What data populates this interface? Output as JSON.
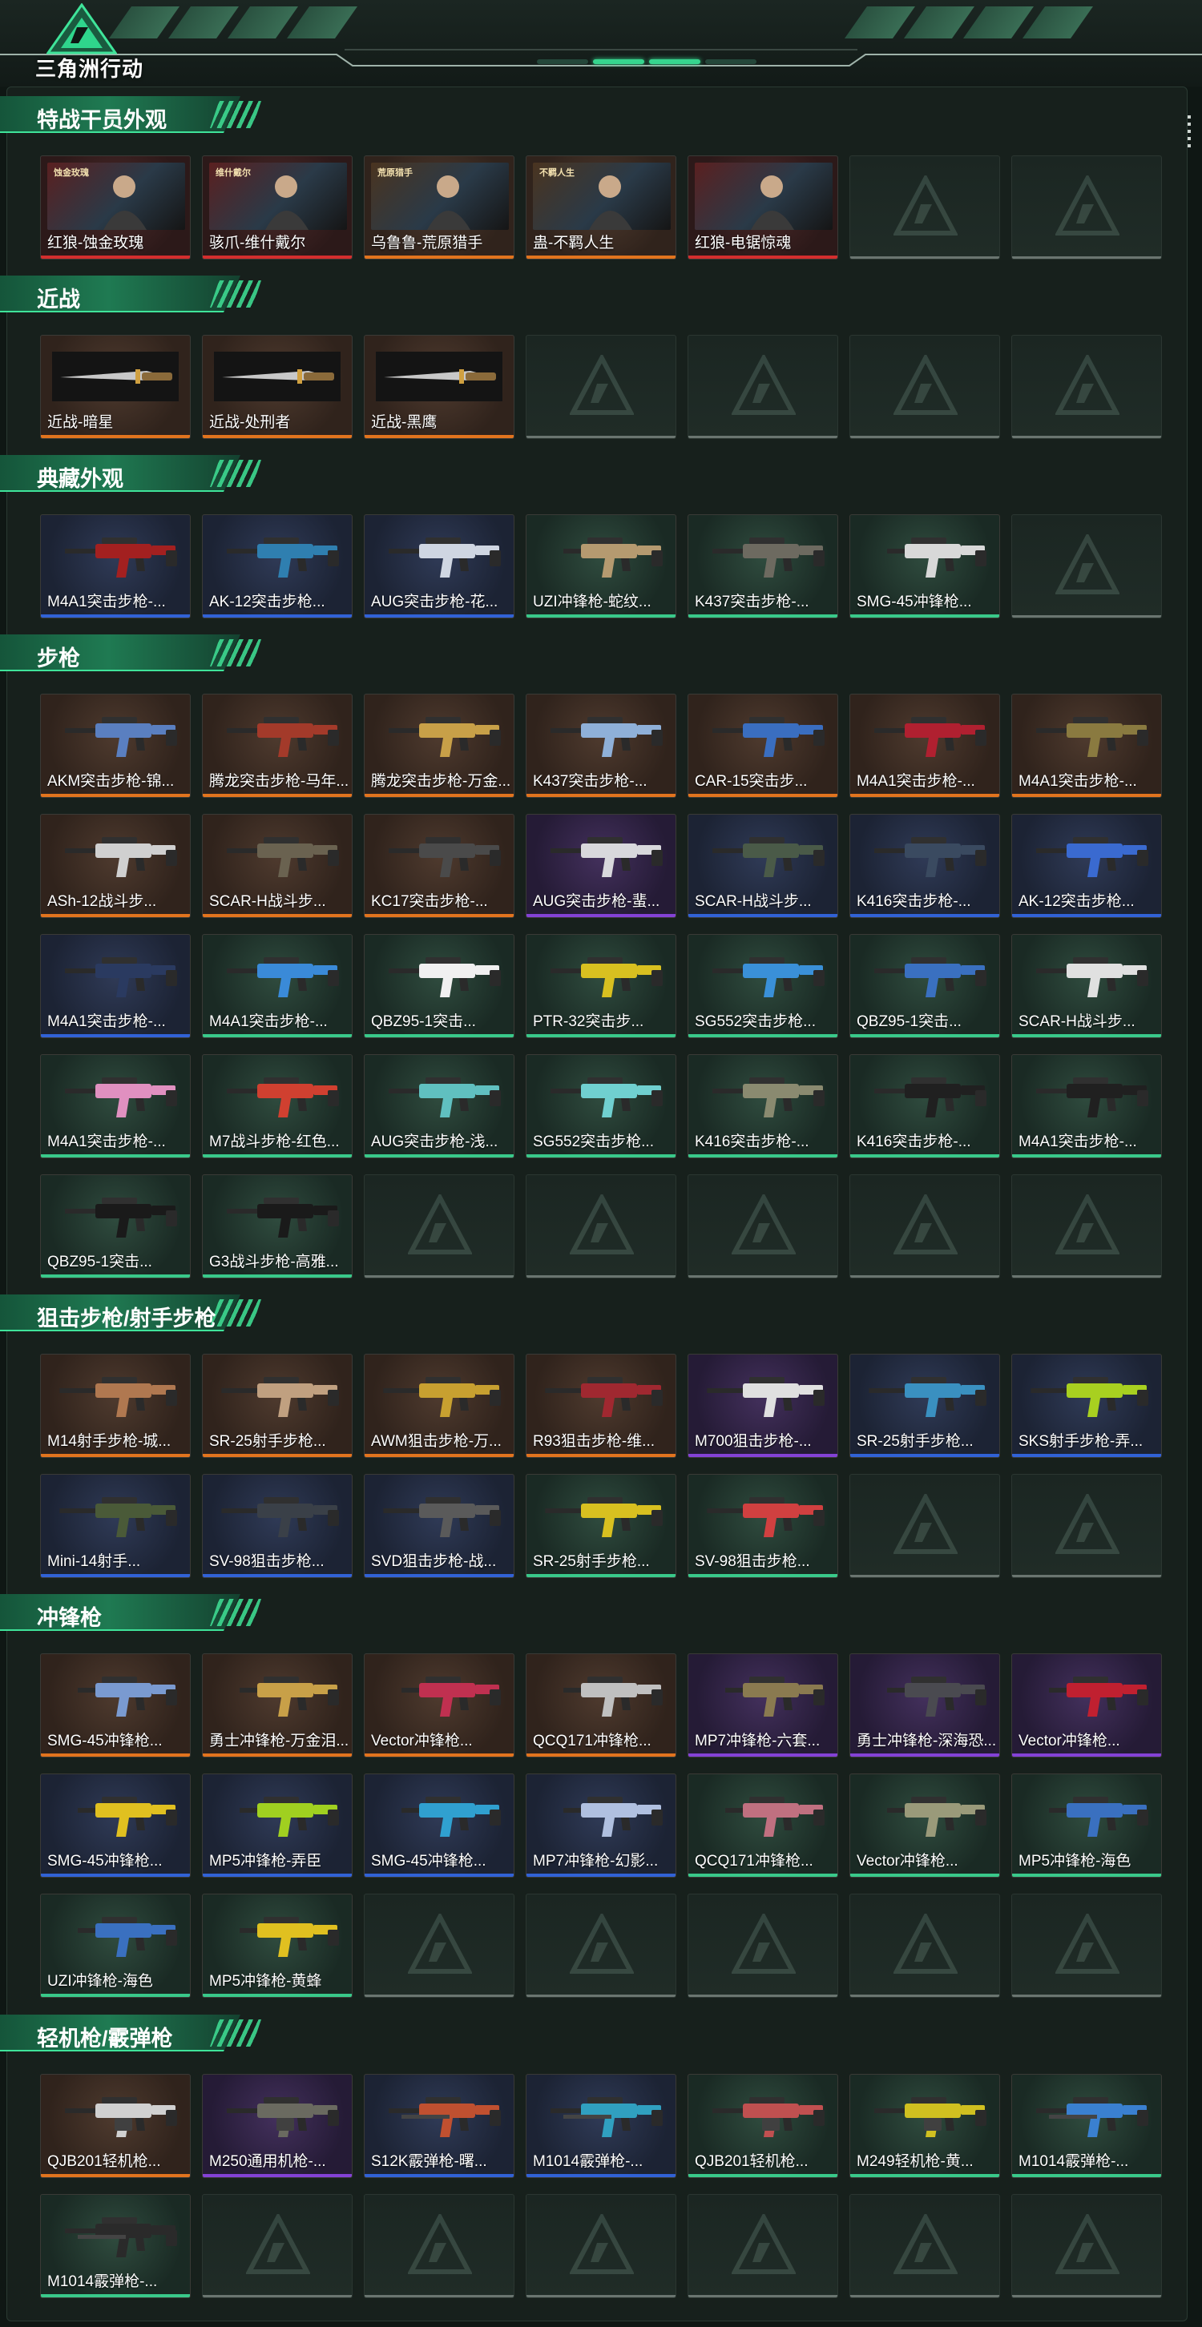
{
  "app": {
    "title": "三角洲行动"
  },
  "theme": {
    "quality_colors": {
      "orange": "#e2741e",
      "blue": "#3162d6",
      "green": "#39c98a",
      "purple": "#8442d6",
      "red": "#d42e2e",
      "empty": "#6a7570"
    }
  },
  "sections": [
    {
      "title": "特战干员外观",
      "kind": "operator",
      "items": [
        {
          "label": "红狼-蚀金玫瑰",
          "quality": "red",
          "icon": "operator-portrait-icon",
          "tag": "蚀金玫瑰"
        },
        {
          "label": "骇爪-维什戴尔",
          "quality": "red",
          "icon": "operator-portrait-icon",
          "tag": "维什戴尔"
        },
        {
          "label": "乌鲁鲁-荒原猎手",
          "quality": "orange",
          "icon": "operator-portrait-icon",
          "tag": "荒原猎手"
        },
        {
          "label": "蛊-不羁人生",
          "quality": "orange",
          "icon": "operator-portrait-icon",
          "tag": "不羁人生"
        },
        {
          "label": "红狼-电锯惊魂",
          "quality": "red",
          "icon": "operator-portrait-icon",
          "tag": ""
        },
        {
          "label": "",
          "quality": "empty"
        },
        {
          "label": "",
          "quality": "empty"
        }
      ]
    },
    {
      "title": "近战",
      "kind": "melee",
      "items": [
        {
          "label": "近战-暗星",
          "quality": "orange",
          "icon": "knife-icon"
        },
        {
          "label": "近战-处刑者",
          "quality": "orange",
          "icon": "knife-icon"
        },
        {
          "label": "近战-黑鹰",
          "quality": "orange",
          "icon": "knife-icon"
        },
        {
          "label": "",
          "quality": "empty"
        },
        {
          "label": "",
          "quality": "empty"
        },
        {
          "label": "",
          "quality": "empty"
        },
        {
          "label": "",
          "quality": "empty"
        }
      ]
    },
    {
      "title": "典藏外观",
      "kind": "gun",
      "items": [
        {
          "label": "M4A1突击步枪-...",
          "quality": "blue",
          "icon": "rifle-icon",
          "skin": "#a32020"
        },
        {
          "label": "AK-12突击步枪...",
          "quality": "blue",
          "icon": "rifle-icon",
          "skin": "#2f7fb0"
        },
        {
          "label": "AUG突击步枪-花...",
          "quality": "blue",
          "icon": "rifle-icon",
          "skin": "#cfd6e2"
        },
        {
          "label": "UZI冲锋枪-蛇纹...",
          "quality": "green",
          "icon": "smg-icon",
          "skin": "#b59a70"
        },
        {
          "label": "K437突击步枪-...",
          "quality": "green",
          "icon": "rifle-icon",
          "skin": "#6d6a60"
        },
        {
          "label": "SMG-45冲锋枪...",
          "quality": "green",
          "icon": "smg-icon",
          "skin": "#d8d8d8"
        },
        {
          "label": "",
          "quality": "empty"
        }
      ]
    },
    {
      "title": "步枪",
      "kind": "gun",
      "items": [
        {
          "label": "AKM突击步枪-锦...",
          "quality": "orange",
          "icon": "rifle-icon",
          "skin": "#5a7fc0"
        },
        {
          "label": "腾龙突击步枪-马年...",
          "quality": "orange",
          "icon": "rifle-icon",
          "skin": "#a33a2a"
        },
        {
          "label": "腾龙突击步枪-万金...",
          "quality": "orange",
          "icon": "rifle-icon",
          "skin": "#c8a048"
        },
        {
          "label": "K437突击步枪-...",
          "quality": "orange",
          "icon": "rifle-icon",
          "skin": "#8fb0d8"
        },
        {
          "label": "CAR-15突击步...",
          "quality": "orange",
          "icon": "rifle-icon",
          "skin": "#3a6ec0"
        },
        {
          "label": "M4A1突击步枪-...",
          "quality": "orange",
          "icon": "rifle-icon",
          "skin": "#b02030"
        },
        {
          "label": "M4A1突击步枪-...",
          "quality": "orange",
          "icon": "rifle-icon",
          "skin": "#8a7a40"
        },
        {
          "label": "ASh-12战斗步...",
          "quality": "orange",
          "icon": "rifle-icon",
          "skin": "#d0d0d0"
        },
        {
          "label": "SCAR-H战斗步...",
          "quality": "orange",
          "icon": "rifle-icon",
          "skin": "#6a6250"
        },
        {
          "label": "KC17突击步枪-...",
          "quality": "orange",
          "icon": "rifle-icon",
          "skin": "#4a4a4a"
        },
        {
          "label": "AUG突击步枪-蜚...",
          "quality": "purple",
          "icon": "rifle-icon",
          "skin": "#d8d8dc"
        },
        {
          "label": "SCAR-H战斗步...",
          "quality": "blue",
          "icon": "rifle-icon",
          "skin": "#4a5a48"
        },
        {
          "label": "K416突击步枪-...",
          "quality": "blue",
          "icon": "rifle-icon",
          "skin": "#3a4a60"
        },
        {
          "label": "AK-12突击步枪...",
          "quality": "blue",
          "icon": "rifle-icon",
          "skin": "#3a6ad0"
        },
        {
          "label": "M4A1突击步枪-...",
          "quality": "blue",
          "icon": "rifle-icon",
          "skin": "#2a3a60"
        },
        {
          "label": "M4A1突击步枪-...",
          "quality": "green",
          "icon": "rifle-icon",
          "skin": "#3a8ad8"
        },
        {
          "label": "QBZ95-1突击...",
          "quality": "green",
          "icon": "rifle-icon",
          "skin": "#f0f0f0"
        },
        {
          "label": "PTR-32突击步...",
          "quality": "green",
          "icon": "rifle-icon",
          "skin": "#d8c020"
        },
        {
          "label": "SG552突击步枪...",
          "quality": "green",
          "icon": "rifle-icon",
          "skin": "#3a90d8"
        },
        {
          "label": "QBZ95-1突击...",
          "quality": "green",
          "icon": "rifle-icon",
          "skin": "#3a70c0"
        },
        {
          "label": "SCAR-H战斗步...",
          "quality": "green",
          "icon": "rifle-icon",
          "skin": "#e0e0e0"
        },
        {
          "label": "M4A1突击步枪-...",
          "quality": "green",
          "icon": "rifle-icon",
          "skin": "#e090c0"
        },
        {
          "label": "M7战斗步枪-红色...",
          "quality": "green",
          "icon": "rifle-icon",
          "skin": "#d04030"
        },
        {
          "label": "AUG突击步枪-浅...",
          "quality": "green",
          "icon": "rifle-icon",
          "skin": "#60c0c0"
        },
        {
          "label": "SG552突击步枪...",
          "quality": "green",
          "icon": "rifle-icon",
          "skin": "#70d0d0"
        },
        {
          "label": "K416突击步枪-...",
          "quality": "green",
          "icon": "rifle-icon",
          "skin": "#8a8a70"
        },
        {
          "label": "K416突击步枪-...",
          "quality": "green",
          "icon": "rifle-icon",
          "skin": "#202020"
        },
        {
          "label": "M4A1突击步枪-...",
          "quality": "green",
          "icon": "rifle-icon",
          "skin": "#202020"
        },
        {
          "label": "QBZ95-1突击...",
          "quality": "green",
          "icon": "rifle-icon",
          "skin": "#1a1a1a"
        },
        {
          "label": "G3战斗步枪-高雅...",
          "quality": "green",
          "icon": "rifle-icon",
          "skin": "#1a1a1a"
        },
        {
          "label": "",
          "quality": "empty"
        },
        {
          "label": "",
          "quality": "empty"
        },
        {
          "label": "",
          "quality": "empty"
        },
        {
          "label": "",
          "quality": "empty"
        },
        {
          "label": "",
          "quality": "empty"
        }
      ]
    },
    {
      "title": "狙击步枪/射手步枪",
      "kind": "gun",
      "items": [
        {
          "label": "M14射手步枪-城...",
          "quality": "orange",
          "icon": "sniper-icon",
          "skin": "#b07850"
        },
        {
          "label": "SR-25射手步枪...",
          "quality": "orange",
          "icon": "sniper-icon",
          "skin": "#c0a080"
        },
        {
          "label": "AWM狙击步枪-万...",
          "quality": "orange",
          "icon": "sniper-icon",
          "skin": "#c8a030"
        },
        {
          "label": "R93狙击步枪-维...",
          "quality": "orange",
          "icon": "sniper-icon",
          "skin": "#a02830"
        },
        {
          "label": "M700狙击步枪-...",
          "quality": "purple",
          "icon": "sniper-icon",
          "skin": "#e0e0e0"
        },
        {
          "label": "SR-25射手步枪...",
          "quality": "blue",
          "icon": "sniper-icon",
          "skin": "#3a90c0"
        },
        {
          "label": "SKS射手步枪-弄...",
          "quality": "blue",
          "icon": "sniper-icon",
          "skin": "#a8d020"
        },
        {
          "label": "Mini-14射手...",
          "quality": "blue",
          "icon": "sniper-icon",
          "skin": "#4a5a38"
        },
        {
          "label": "SV-98狙击步枪...",
          "quality": "blue",
          "icon": "sniper-icon",
          "skin": "#3a4048"
        },
        {
          "label": "SVD狙击步枪-战...",
          "quality": "blue",
          "icon": "sniper-icon",
          "skin": "#5a5a5a"
        },
        {
          "label": "SR-25射手步枪...",
          "quality": "green",
          "icon": "sniper-icon",
          "skin": "#d8c020"
        },
        {
          "label": "SV-98狙击步枪...",
          "quality": "green",
          "icon": "sniper-icon",
          "skin": "#d04040"
        },
        {
          "label": "",
          "quality": "empty"
        },
        {
          "label": "",
          "quality": "empty"
        }
      ]
    },
    {
      "title": "冲锋枪",
      "kind": "gun",
      "items": [
        {
          "label": "SMG-45冲锋枪...",
          "quality": "orange",
          "icon": "smg-icon",
          "skin": "#7a9ad0"
        },
        {
          "label": "勇士冲锋枪-万金泪...",
          "quality": "orange",
          "icon": "smg-icon",
          "skin": "#c8a048"
        },
        {
          "label": "Vector冲锋枪...",
          "quality": "orange",
          "icon": "smg-icon",
          "skin": "#c03050"
        },
        {
          "label": "QCQ171冲锋枪...",
          "quality": "orange",
          "icon": "smg-icon",
          "skin": "#c0c0c0"
        },
        {
          "label": "MP7冲锋枪-六套...",
          "quality": "purple",
          "icon": "smg-icon",
          "skin": "#8a7a50"
        },
        {
          "label": "勇士冲锋枪-深海恐...",
          "quality": "purple",
          "icon": "smg-icon",
          "skin": "#4a4a50"
        },
        {
          "label": "Vector冲锋枪...",
          "quality": "purple",
          "icon": "smg-icon",
          "skin": "#c02030"
        },
        {
          "label": "SMG-45冲锋枪...",
          "quality": "blue",
          "icon": "smg-icon",
          "skin": "#e0c020"
        },
        {
          "label": "MP5冲锋枪-弄臣",
          "quality": "blue",
          "icon": "smg-icon",
          "skin": "#a0d020"
        },
        {
          "label": "SMG-45冲锋枪...",
          "quality": "blue",
          "icon": "smg-icon",
          "skin": "#30a0d0"
        },
        {
          "label": "MP7冲锋枪-幻影...",
          "quality": "blue",
          "icon": "smg-icon",
          "skin": "#b0c0e0"
        },
        {
          "label": "QCQ171冲锋枪...",
          "quality": "green",
          "icon": "smg-icon",
          "skin": "#c07080"
        },
        {
          "label": "Vector冲锋枪...",
          "quality": "green",
          "icon": "smg-icon",
          "skin": "#9a9a7a"
        },
        {
          "label": "MP5冲锋枪-海色",
          "quality": "green",
          "icon": "smg-icon",
          "skin": "#3a70c0"
        },
        {
          "label": "UZI冲锋枪-海色",
          "quality": "green",
          "icon": "smg-icon",
          "skin": "#3a70c0"
        },
        {
          "label": "MP5冲锋枪-黄蜂",
          "quality": "green",
          "icon": "smg-icon",
          "skin": "#e0c020"
        },
        {
          "label": "",
          "quality": "empty"
        },
        {
          "label": "",
          "quality": "empty"
        },
        {
          "label": "",
          "quality": "empty"
        },
        {
          "label": "",
          "quality": "empty"
        },
        {
          "label": "",
          "quality": "empty"
        }
      ]
    },
    {
      "title": "轻机枪/霰弹枪",
      "kind": "gun",
      "items": [
        {
          "label": "QJB201轻机枪...",
          "quality": "orange",
          "icon": "lmg-icon",
          "skin": "#d0d0d0"
        },
        {
          "label": "M250通用机枪-...",
          "quality": "purple",
          "icon": "lmg-icon",
          "skin": "#6a6a60"
        },
        {
          "label": "S12K霰弹枪-曙...",
          "quality": "blue",
          "icon": "shotgun-icon",
          "skin": "#c05030"
        },
        {
          "label": "M1014霰弹枪-...",
          "quality": "blue",
          "icon": "shotgun-icon",
          "skin": "#30a0c0"
        },
        {
          "label": "QJB201轻机枪...",
          "quality": "green",
          "icon": "lmg-icon",
          "skin": "#c05050"
        },
        {
          "label": "M249轻机枪-黄...",
          "quality": "green",
          "icon": "lmg-icon",
          "skin": "#d0c020"
        },
        {
          "label": "M1014霰弹枪-...",
          "quality": "green",
          "icon": "shotgun-icon",
          "skin": "#3a80d0"
        },
        {
          "label": "M1014霰弹枪-...",
          "quality": "green",
          "icon": "shotgun-icon",
          "skin": "#2a2a2a"
        },
        {
          "label": "",
          "quality": "empty"
        },
        {
          "label": "",
          "quality": "empty"
        },
        {
          "label": "",
          "quality": "empty"
        },
        {
          "label": "",
          "quality": "empty"
        },
        {
          "label": "",
          "quality": "empty"
        },
        {
          "label": "",
          "quality": "empty"
        }
      ]
    }
  ]
}
